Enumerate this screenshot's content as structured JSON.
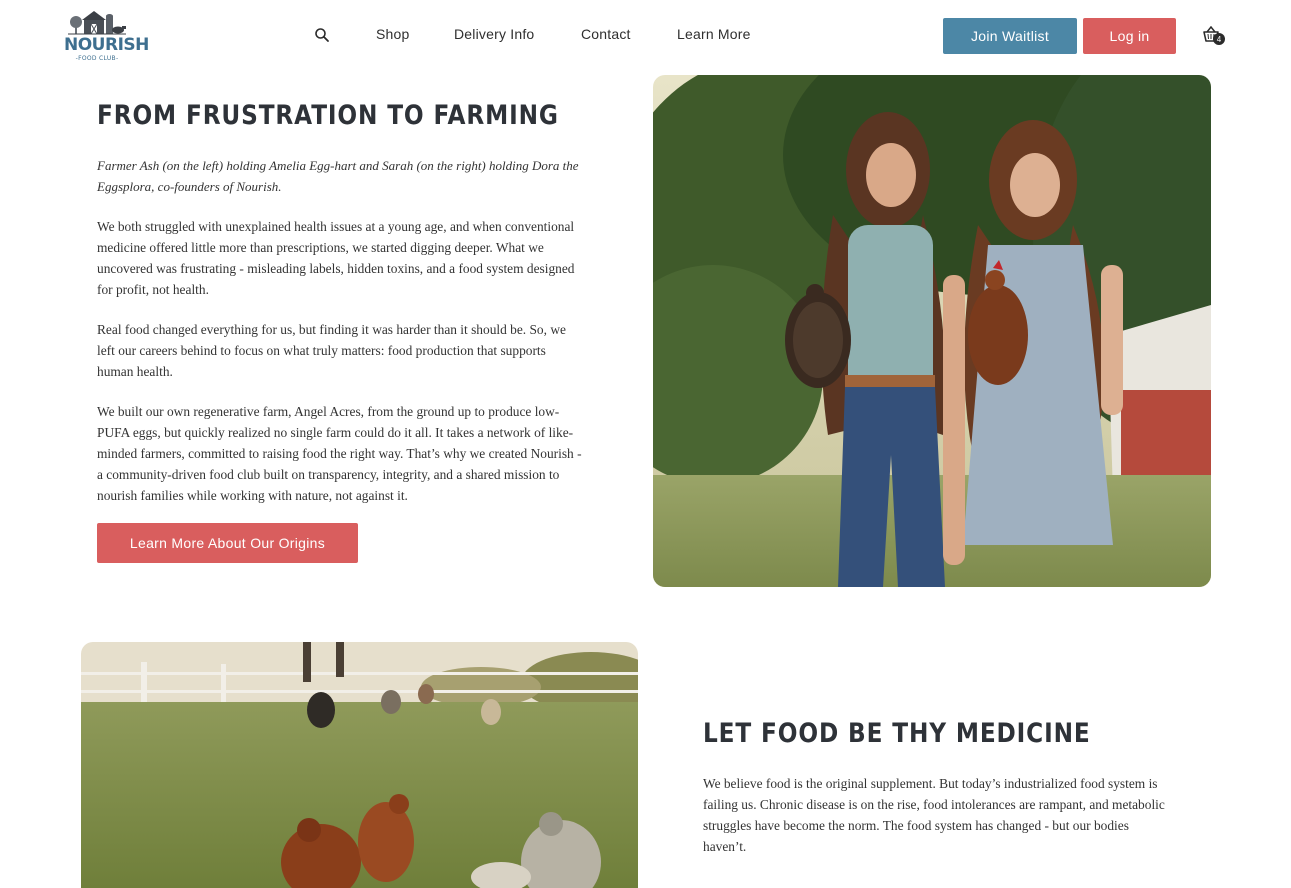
{
  "brand": {
    "logo_name": "NOURISH",
    "logo_sub": "FOOD CLUB",
    "logo_color": "#3e6f8f"
  },
  "nav": {
    "search_icon": "search-icon",
    "links": [
      "Shop",
      "Delivery Info",
      "Contact",
      "Learn More"
    ],
    "join_label": "Join Waitlist",
    "login_label": "Log in",
    "cart_icon": "basket-icon",
    "cart_count": "4"
  },
  "colors": {
    "accent_blue": "#4c87a6",
    "accent_red": "#d95e5e",
    "text_dark": "#2e3238"
  },
  "section1": {
    "title": "FROM FRUSTRATION TO FARMING",
    "caption": "Farmer Ash (on the left) holding Amelia Egg-hart and Sarah (on the right) holding Dora the Eggsplora, co-founders of Nourish.",
    "paragraphs": [
      "We both struggled with unexplained health issues at a young age, and when conventional medicine offered little more than prescriptions, we started digging deeper. What we uncovered was frustrating - misleading labels, hidden toxins, and a food system designed for profit, not health.",
      "Real food changed everything for us, but finding it was harder than it should be. So, we left our careers behind to focus on what truly matters: food production that supports human health.",
      "We built our own regenerative farm, Angel Acres, from the ground up to produce low-PUFA eggs, but quickly realized no single farm could do it all. It takes a network of like-minded farmers, committed to raising food the right way. That’s why we created Nourish - a community-driven food club built on transparency, integrity, and a shared mission to nourish families while working with nature, not against it."
    ],
    "button_label": "Learn More About Our Origins",
    "photo": "two-farmers-holding-hens-photo"
  },
  "section2": {
    "title": "LET FOOD BE THY MEDICINE",
    "paragraph": "We believe food is the original supplement. But today’s industrialized food system is failing us. Chronic disease is on the rise, food intolerances are rampant, and metabolic struggles have become the norm. The food system has changed - but our bodies haven’t.",
    "photo": "chickens-in-pasture-photo"
  }
}
